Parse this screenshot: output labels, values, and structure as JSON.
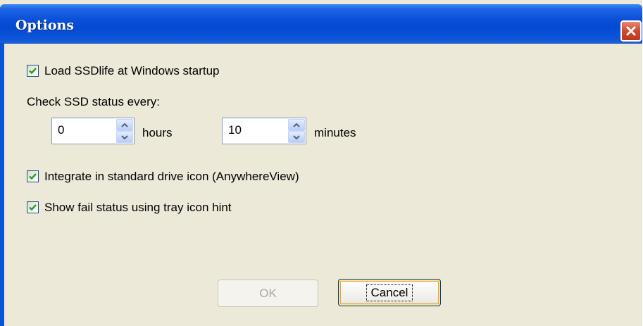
{
  "window": {
    "title": "Options",
    "close_icon": "close-icon"
  },
  "options": {
    "load_at_startup": {
      "label": "Load SSDlife at Windows startup",
      "checked": true
    },
    "check_status_label": "Check SSD status every:",
    "hours": {
      "value": "0",
      "unit_label": "hours"
    },
    "minutes": {
      "value": "10",
      "unit_label": "minutes"
    },
    "integrate_drive_icon": {
      "label": "Integrate in standard drive icon (AnywhereView)",
      "checked": true
    },
    "show_fail_status": {
      "label": "Show fail status using tray icon hint",
      "checked": true
    }
  },
  "buttons": {
    "ok_label": "OK",
    "cancel_label": "Cancel"
  },
  "colors": {
    "titlebar": "#0449d2",
    "dialog_bg": "#ece9d8",
    "check_mark": "#21a121",
    "close_button": "#d2482a"
  }
}
